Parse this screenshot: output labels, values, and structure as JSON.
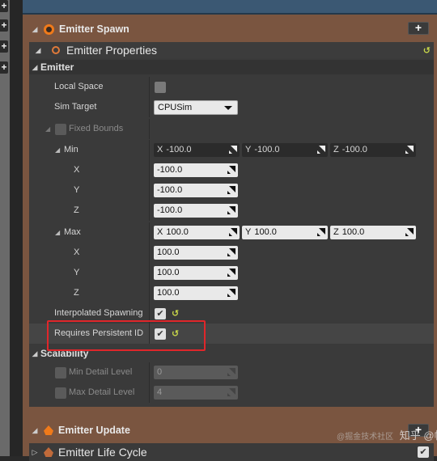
{
  "sections": {
    "emitter_spawn": {
      "title": "Emitter Spawn",
      "add_label": "+"
    },
    "emitter_properties": {
      "title": "Emitter Properties",
      "reset_label": "↺"
    },
    "emitter_update": {
      "title": "Emitter Update",
      "add_label": "+"
    },
    "emitter_life_cycle": {
      "title": "Emitter Life Cycle"
    }
  },
  "emitter": {
    "category_label": "Emitter",
    "local_space_label": "Local Space",
    "local_space_checked": false,
    "sim_target_label": "Sim Target",
    "sim_target_value": "CPUSim",
    "fixed_bounds_label": "Fixed Bounds",
    "fixed_bounds_checked": false,
    "min": {
      "label": "Min",
      "x_axis": "X",
      "y_axis": "Y",
      "z_axis": "Z",
      "x": "-100.0",
      "y": "-100.0",
      "z": "-100.0"
    },
    "max": {
      "label": "Max",
      "x_axis": "X",
      "y_axis": "Y",
      "z_axis": "Z",
      "x": "100.0",
      "y": "100.0",
      "z": "100.0"
    },
    "interpolated_spawning_label": "Interpolated Spawning",
    "interpolated_spawning_checked": true,
    "requires_persistent_id_label": "Requires Persistent ID",
    "requires_persistent_id_checked": true,
    "check_mark": "✔",
    "reset_label": "↺"
  },
  "scalability": {
    "category_label": "Scalability",
    "min_detail_level_label": "Min Detail Level",
    "min_detail_level_value": "0",
    "max_detail_level_label": "Max Detail Level",
    "max_detail_level_value": "4"
  },
  "left_toolbar": {
    "plus_label": "+"
  },
  "watermark": {
    "prefix": "@掘金技术社区",
    "text": "知乎 @帆起"
  }
}
